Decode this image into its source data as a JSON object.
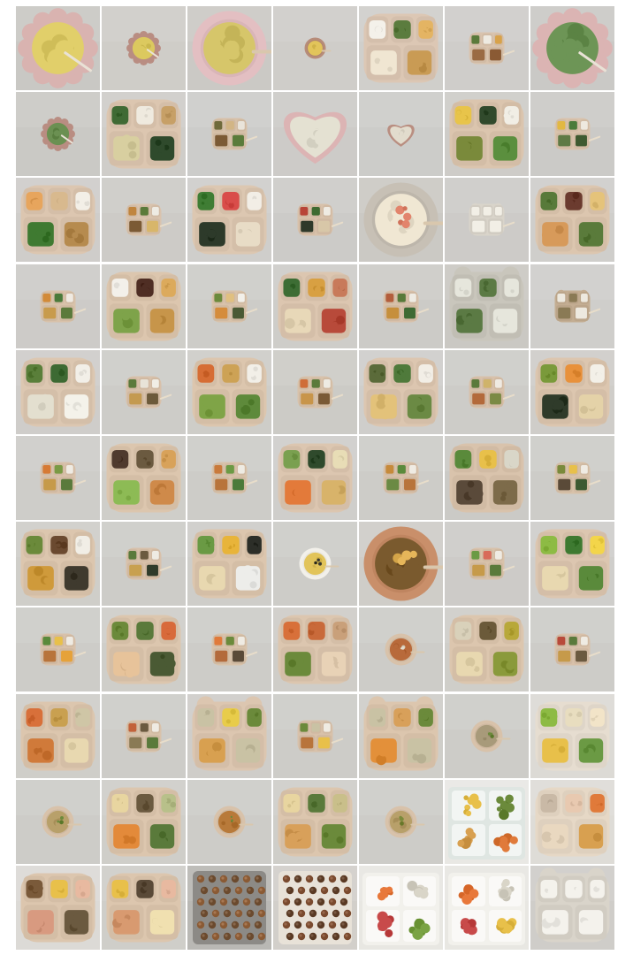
{
  "gallery": {
    "columns": 7,
    "tiles": [
      {
        "bg": "#c9c8c4",
        "plate": "scallop",
        "plate_color": "#d9b3b0",
        "food": [
          "#e1cf6a"
        ],
        "scale": "large"
      },
      {
        "bg": "#cfcdc8",
        "plate": "scallop",
        "plate_color": "#b98d82",
        "food": [
          "#dcc95f"
        ],
        "scale": "small"
      },
      {
        "bg": "#cbc9c5",
        "plate": "bowl",
        "plate_color": "#e3bfc2",
        "food": [
          "#d6c66a"
        ],
        "scale": "large"
      },
      {
        "bg": "#cfcdc9",
        "plate": "bowl",
        "plate_color": "#b78c79",
        "food": [
          "#e2c45a"
        ],
        "scale": "tiny"
      },
      {
        "bg": "#d0cfcb",
        "plate": "divided",
        "plate_color": "#dcc7b4",
        "food": [
          "#f4f1ea",
          "#5b7c3e",
          "#e4b463",
          "#f0e6d2",
          "#c99b54"
        ],
        "scale": "large"
      },
      {
        "bg": "#cfcdca",
        "plate": "divided",
        "plate_color": "#d9c3ad",
        "food": [
          "#5a7a3b",
          "#eeeae1",
          "#d8a24a",
          "#9a6b44",
          "#8a5a34"
        ],
        "scale": "small"
      },
      {
        "bg": "#cac9c6",
        "plate": "scallop",
        "plate_color": "#dbb4b3",
        "food": [
          "#6d9556"
        ],
        "scale": "large"
      },
      {
        "bg": "#cac9c5",
        "plate": "scallop",
        "plate_color": "#b98d82",
        "food": [
          "#6b9052"
        ],
        "scale": "small"
      },
      {
        "bg": "#cfcdc9",
        "plate": "divided",
        "plate_color": "#dcc6b0",
        "food": [
          "#3f6a34",
          "#efeadf",
          "#c7a067",
          "#d8cfa0",
          "#2f4a2c"
        ],
        "scale": "large"
      },
      {
        "bg": "#ccccca",
        "plate": "divided",
        "plate_color": "#d7c1a9",
        "food": [
          "#6f6a3b",
          "#d2b585",
          "#e9e4da",
          "#7b5a35",
          "#5a7b3b"
        ],
        "scale": "small"
      },
      {
        "bg": "#cdcbc8",
        "plate": "heart",
        "plate_color": "#dcb4b4",
        "food": [
          "#e4e1d2"
        ],
        "scale": "large"
      },
      {
        "bg": "#ccccc9",
        "plate": "heart",
        "plate_color": "#b98e81",
        "food": [
          "#e2dccd"
        ],
        "scale": "small"
      },
      {
        "bg": "#ceccc8",
        "plate": "divided",
        "plate_color": "#dbc5ae",
        "food": [
          "#e8c44a",
          "#314a2c",
          "#f1eee5",
          "#7a8a3b",
          "#5b8f3e"
        ],
        "scale": "large"
      },
      {
        "bg": "#cbcac7",
        "plate": "divided",
        "plate_color": "#d9c3ac",
        "food": [
          "#e2b843",
          "#4a7b3b",
          "#eee9df",
          "#5f7a45",
          "#3f5a30"
        ],
        "scale": "small"
      },
      {
        "bg": "#cfcdca",
        "plate": "divided",
        "plate_color": "#dcc6b0",
        "food": [
          "#e7a55d",
          "#d8b98e",
          "#f3efe7",
          "#3f7a31",
          "#b68b4f"
        ],
        "scale": "large"
      },
      {
        "bg": "#cdcbc7",
        "plate": "divided",
        "plate_color": "#d9c3ad",
        "food": [
          "#c0853e",
          "#5a7a3a",
          "#eeebe3",
          "#7b5a35",
          "#d8b66a"
        ],
        "scale": "small"
      },
      {
        "bg": "#cfcecb",
        "plate": "divided",
        "plate_color": "#dcc7b1",
        "food": [
          "#3f7d34",
          "#d94d4a",
          "#f2eee6",
          "#2d3a2a",
          "#e8dcc6"
        ],
        "scale": "large"
      },
      {
        "bg": "#cccbc8",
        "plate": "divided",
        "plate_color": "#d8c1aa",
        "food": [
          "#b84437",
          "#3e6b31",
          "#efebe3",
          "#2e392a",
          "#d8c7a8"
        ],
        "scale": "small"
      },
      {
        "bg": "#cbc9c4",
        "plate": "round",
        "plate_color": "#c7c0b5",
        "food": [
          "#f0e7d3",
          "#e2846c"
        ],
        "scale": "large"
      },
      {
        "bg": "#cdcbc8",
        "plate": "bear",
        "plate_color": "#d9d4ca",
        "food": [
          "#f2efe6"
        ],
        "scale": "small"
      },
      {
        "bg": "#cfcecb",
        "plate": "divided",
        "plate_color": "#dcc6af",
        "food": [
          "#587a3a",
          "#6b3b2f",
          "#e5c37a",
          "#d79a5a",
          "#5a7b3b"
        ],
        "scale": "large"
      },
      {
        "bg": "#cdcbc8",
        "plate": "divided",
        "plate_color": "#d8c2aa",
        "food": [
          "#d28a37",
          "#4a7a3a",
          "#efeae2",
          "#c89b4c",
          "#5b7a3b"
        ],
        "scale": "small"
      },
      {
        "bg": "#cfcec9",
        "plate": "divided",
        "plate_color": "#dcc6ae",
        "food": [
          "#f3f0ea",
          "#4f2e24",
          "#dcaa5c",
          "#7ea34a",
          "#c7954a"
        ],
        "scale": "large"
      },
      {
        "bg": "#cdccc8",
        "plate": "divided",
        "plate_color": "#d8c2aa",
        "food": [
          "#6b8a3b",
          "#e0c080",
          "#f2f0ea",
          "#d58c3b",
          "#4a5a34"
        ],
        "scale": "small"
      },
      {
        "bg": "#cecdc9",
        "plate": "divided",
        "plate_color": "#dcc6b0",
        "food": [
          "#3d6d34",
          "#d8a042",
          "#c87a5a",
          "#e8d8b8",
          "#b84a3a"
        ],
        "scale": "large"
      },
      {
        "bg": "#cccbc7",
        "plate": "divided",
        "plate_color": "#d8c1aa",
        "food": [
          "#b35e3c",
          "#587a3a",
          "#eeebe3",
          "#c68f3c",
          "#3d6a33"
        ],
        "scale": "small"
      },
      {
        "bg": "#cac8c3",
        "plate": "bear",
        "plate_color": "#c9c6bc",
        "food": [
          "#e6e6dc",
          "#5b7a44"
        ],
        "scale": "large"
      },
      {
        "bg": "#cfcecb",
        "plate": "bear",
        "plate_color": "#c3ad92",
        "food": [
          "#ede9df",
          "#8a7a55"
        ],
        "scale": "small"
      },
      {
        "bg": "#cfcdca",
        "plate": "divided",
        "plate_color": "#dcc7b1",
        "food": [
          "#5a7f3a",
          "#3d6a33",
          "#f2efe8",
          "#e3dfcf",
          "#f4f2ea"
        ],
        "scale": "large"
      },
      {
        "bg": "#cdccc8",
        "plate": "divided",
        "plate_color": "#d8c1aa",
        "food": [
          "#5b7a3b",
          "#e8e3d8",
          "#f1eee6",
          "#c49a50",
          "#6c5a3b"
        ],
        "scale": "small"
      },
      {
        "bg": "#cecdc8",
        "plate": "divided",
        "plate_color": "#dcc6ae",
        "food": [
          "#d66d34",
          "#cda255",
          "#f2efe8",
          "#7fa447",
          "#5e8a3b"
        ],
        "scale": "large"
      },
      {
        "bg": "#cccbc6",
        "plate": "divided",
        "plate_color": "#d8c2aa",
        "food": [
          "#cf6d38",
          "#5a7a3b",
          "#eeebe3",
          "#c8954a",
          "#7a5a36"
        ],
        "scale": "small"
      },
      {
        "bg": "#cfcecb",
        "plate": "divided",
        "plate_color": "#dcc6b0",
        "food": [
          "#5b6b3a",
          "#4f7a3b",
          "#f2eee6",
          "#e3c27a",
          "#6b8a44"
        ],
        "scale": "large"
      },
      {
        "bg": "#cdccc8",
        "plate": "divided",
        "plate_color": "#d8c1aa",
        "food": [
          "#5a7a3b",
          "#cfb36a",
          "#efeae2",
          "#b36a3b",
          "#7b8a44"
        ],
        "scale": "small"
      },
      {
        "bg": "#cfcdc9",
        "plate": "divided",
        "plate_color": "#dcc6af",
        "food": [
          "#7a9a3b",
          "#e8913b",
          "#f3f0e8",
          "#2f3b2a",
          "#e4d2a8"
        ],
        "scale": "large"
      },
      {
        "bg": "#cecdc9",
        "plate": "divided",
        "plate_color": "#d8c1aa",
        "food": [
          "#d67a34",
          "#7a9a44",
          "#efebe3",
          "#c69a4a",
          "#5a7a3b"
        ],
        "scale": "small"
      },
      {
        "bg": "#cfcec9",
        "plate": "divided",
        "plate_color": "#dcc6ae",
        "food": [
          "#4f3a2e",
          "#6b5a40",
          "#d8a25a",
          "#8dbb55",
          "#cf8a4a"
        ],
        "scale": "large"
      },
      {
        "bg": "#cdccc8",
        "plate": "divided",
        "plate_color": "#d8c2aa",
        "food": [
          "#c97a3b",
          "#6b9a44",
          "#eeebe3",
          "#b8743b",
          "#4a7a3a"
        ],
        "scale": "small"
      },
      {
        "bg": "#cfcecb",
        "plate": "divided",
        "plate_color": "#dcc6b0",
        "food": [
          "#7aa050",
          "#2f4a2c",
          "#e8ddb6",
          "#e37a3a",
          "#d8b36a"
        ],
        "scale": "large"
      },
      {
        "bg": "#cdccc8",
        "plate": "divided",
        "plate_color": "#d8c1aa",
        "food": [
          "#c68a3b",
          "#5a8a3b",
          "#efebe3",
          "#6b8a44",
          "#b8743b"
        ],
        "scale": "small"
      },
      {
        "bg": "#cbcac6",
        "plate": "divided",
        "plate_color": "#d9c3ac",
        "food": [
          "#5a8a3b",
          "#e8c04a",
          "#d9d6c8",
          "#5a4a3a",
          "#7d6b4a"
        ],
        "scale": "large"
      },
      {
        "bg": "#cdccc8",
        "plate": "divided",
        "plate_color": "#d8c2aa",
        "food": [
          "#7a8a3b",
          "#e8c04a",
          "#efebe3",
          "#5a4a38",
          "#3d5a32"
        ],
        "scale": "small"
      },
      {
        "bg": "#cfcec9",
        "plate": "divided",
        "plate_color": "#dcc6ae",
        "food": [
          "#6b8a3b",
          "#6b4a30",
          "#f1eee6",
          "#cf9a3b",
          "#3f3a2e"
        ],
        "scale": "large"
      },
      {
        "bg": "#cdccc8",
        "plate": "divided",
        "plate_color": "#d8c1aa",
        "food": [
          "#5a7a3b",
          "#6b5a40",
          "#eeebe3",
          "#c8a050",
          "#2f3b2a"
        ],
        "scale": "small"
      },
      {
        "bg": "#cecdc9",
        "plate": "divided",
        "plate_color": "#dcc6ae",
        "food": [
          "#6a9a44",
          "#e8b43a",
          "#2c2e28",
          "#e8d8b0",
          "#ededea"
        ],
        "scale": "large"
      },
      {
        "bg": "#cdccc8",
        "plate": "bowl",
        "plate_color": "#f2f0ea",
        "food": [
          "#e2c45a",
          "#3b3a30"
        ],
        "scale": "small"
      },
      {
        "bg": "#cfcdc8",
        "plate": "bowl",
        "plate_color": "#c98f6a",
        "food": [
          "#7a5a2e",
          "#e6b65a"
        ],
        "scale": "large"
      },
      {
        "bg": "#cdcbc8",
        "plate": "divided",
        "plate_color": "#d8c2aa",
        "food": [
          "#6b9a44",
          "#d86a5a",
          "#efebe3",
          "#c69a4a",
          "#5a7a3b"
        ],
        "scale": "small"
      },
      {
        "bg": "#cfcecb",
        "plate": "divided",
        "plate_color": "#dcc6b0",
        "food": [
          "#8dbb44",
          "#3e7a31",
          "#f3d54a",
          "#e8d8b0",
          "#5a8a3b"
        ],
        "scale": "large"
      },
      {
        "bg": "#cdccc8",
        "plate": "divided",
        "plate_color": "#d8c1aa",
        "food": [
          "#5a8a3b",
          "#e8c04a",
          "#efebe3",
          "#b8743b",
          "#e6a23a"
        ],
        "scale": "small"
      },
      {
        "bg": "#cfcec9",
        "plate": "divided",
        "plate_color": "#dcc6ae",
        "food": [
          "#6b8a3b",
          "#5a7a3b",
          "#d86a3a",
          "#e7c39a",
          "#4a5a34"
        ],
        "scale": "large"
      },
      {
        "bg": "#cdccc8",
        "plate": "divided",
        "plate_color": "#d8c2aa",
        "food": [
          "#e07a3a",
          "#6b8a3b",
          "#efebe3",
          "#b36a3b",
          "#5a4a38"
        ],
        "scale": "small"
      },
      {
        "bg": "#cfcdc8",
        "plate": "divided",
        "plate_color": "#dcc6af",
        "food": [
          "#d8703a",
          "#c96a3a",
          "#c9a07a",
          "#6b8a3b",
          "#e8d2b6"
        ],
        "scale": "large"
      },
      {
        "bg": "#cdccc8",
        "plate": "round",
        "plate_color": "#d8c2aa",
        "food": [
          "#b86a3b",
          "#e3dccc"
        ],
        "scale": "small"
      },
      {
        "bg": "#cfcec9",
        "plate": "divided",
        "plate_color": "#dcc6ae",
        "food": [
          "#d9d1ba",
          "#6b5a3a",
          "#b8a83a",
          "#e8d8b0",
          "#8a9a3b"
        ],
        "scale": "large"
      },
      {
        "bg": "#cdccc8",
        "plate": "divided",
        "plate_color": "#d8c1aa",
        "food": [
          "#b84a3a",
          "#5a7a3b",
          "#efebe3",
          "#c69a4a",
          "#6b5a40"
        ],
        "scale": "small"
      },
      {
        "bg": "#cfcec9",
        "plate": "divided",
        "plate_color": "#dcc6ae",
        "food": [
          "#d8703a",
          "#c9a050",
          "#cfc6a6",
          "#d07a3a",
          "#e8d8b0"
        ],
        "scale": "large"
      },
      {
        "bg": "#cdccc8",
        "plate": "divided",
        "plate_color": "#d8c2aa",
        "food": [
          "#c2623a",
          "#6b5a40",
          "#efebe3",
          "#8a7a55",
          "#5a7a3b"
        ],
        "scale": "small"
      },
      {
        "bg": "#cfcdc9",
        "plate": "bear",
        "plate_color": "#dcc6b0",
        "food": [
          "#c9c2a4",
          "#e8cc4a",
          "#6b8a3b",
          "#d8a050"
        ],
        "scale": "large"
      },
      {
        "bg": "#cdccc8",
        "plate": "divided",
        "plate_color": "#d8c1aa",
        "food": [
          "#6b8a3b",
          "#c9c2a4",
          "#efebe3",
          "#b8743b",
          "#e8c04a"
        ],
        "scale": "small"
      },
      {
        "bg": "#cfcec9",
        "plate": "bear",
        "plate_color": "#dcc6ae",
        "food": [
          "#c9c2a4",
          "#d8a05a",
          "#6b8a3b",
          "#e3903a"
        ],
        "scale": "large"
      },
      {
        "bg": "#cdccc8",
        "plate": "round",
        "plate_color": "#d8c2aa",
        "food": [
          "#a89a7a",
          "#6b8a3b"
        ],
        "scale": "small"
      },
      {
        "bg": "#dcdad5",
        "plate": "divided",
        "plate_color": "#e6ddd0",
        "food": [
          "#8dbb44",
          "#e8ddbf",
          "#f2e4c8",
          "#e8c04a",
          "#6b9a44"
        ],
        "scale": "large"
      },
      {
        "bg": "#cdccc8",
        "plate": "round",
        "plate_color": "#d8c2aa",
        "food": [
          "#b8a06a",
          "#6b8a3b"
        ],
        "scale": "small"
      },
      {
        "bg": "#cfcec9",
        "plate": "divided",
        "plate_color": "#dcc6ae",
        "food": [
          "#e8d5a0",
          "#6b5a40",
          "#b8c08a",
          "#e38a3a",
          "#5a7a3b"
        ],
        "scale": "large"
      },
      {
        "bg": "#cdccc8",
        "plate": "round",
        "plate_color": "#d8c2aa",
        "food": [
          "#b87a3a",
          "#6b8a3b"
        ],
        "scale": "small"
      },
      {
        "bg": "#cfcec9",
        "plate": "divided",
        "plate_color": "#dcc6ae",
        "food": [
          "#e8d5a0",
          "#5a7a3b",
          "#c9bf8a",
          "#d8a05a",
          "#6b8a3b"
        ],
        "scale": "large"
      },
      {
        "bg": "#cdccc8",
        "plate": "round",
        "plate_color": "#d8c2aa",
        "food": [
          "#b8a06a",
          "#7a8a3b"
        ],
        "scale": "small"
      },
      {
        "bg": "#e9e8e4",
        "plate": "container",
        "plate_color": "#dfe6e2",
        "food": [
          "#e8c04a",
          "#6b8a3b",
          "#d8a050",
          "#e07a3a"
        ],
        "scale": "large"
      },
      {
        "bg": "#dedcd7",
        "plate": "divided",
        "plate_color": "#e6d8c6",
        "food": [
          "#c9b9a6",
          "#e8c9b0",
          "#e07a3a",
          "#e9d8c0",
          "#d8a050"
        ],
        "scale": "large"
      },
      {
        "bg": "#dcdad6",
        "plate": "divided",
        "plate_color": "#dcc6ae",
        "food": [
          "#7a5a3a",
          "#e8c04a",
          "#e8b9a0",
          "#d89a80",
          "#6b5a40"
        ],
        "scale": "large"
      },
      {
        "bg": "#cfcec9",
        "plate": "divided",
        "plate_color": "#dcc6ae",
        "food": [
          "#e8c04a",
          "#5a4a38",
          "#e8b9a0",
          "#d89a70",
          "#f0e0b0"
        ],
        "scale": "large"
      },
      {
        "bg": "#b9b8b4",
        "plate": "tray",
        "plate_color": "#8c8a86",
        "food": [
          "#8a5a34",
          "#6b4a2e"
        ],
        "scale": "large"
      },
      {
        "bg": "#d2cfca",
        "plate": "tray",
        "plate_color": "#e8e2d8",
        "food": [
          "#7a4a2e",
          "#5a3a24"
        ],
        "scale": "large"
      },
      {
        "bg": "#e8e7e2",
        "plate": "container",
        "plate_color": "#f2f1ec",
        "food": [
          "#e8783a",
          "#d9d5c8",
          "#c84a4a",
          "#7aa344"
        ],
        "scale": "large"
      },
      {
        "bg": "#e8e7e2",
        "plate": "container",
        "plate_color": "#f2f1ec",
        "food": [
          "#e8783a",
          "#d9d5c8",
          "#c84a4a",
          "#e8c04a"
        ],
        "scale": "large"
      },
      {
        "bg": "#cfcdc9",
        "plate": "bear",
        "plate_color": "#d9d4ca",
        "food": [
          "#f4f2ec"
        ],
        "scale": "large"
      }
    ]
  }
}
